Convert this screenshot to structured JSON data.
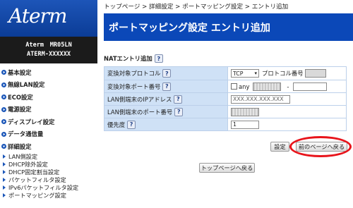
{
  "logo": "Aterm",
  "device": {
    "model": "Aterm　MR05LN",
    "id": "ATERM-XXXXXX"
  },
  "sidebar": {
    "items": [
      {
        "label": "基本設定"
      },
      {
        "label": "無線LAN設定"
      },
      {
        "label": "ECO設定"
      },
      {
        "label": "電源設定"
      },
      {
        "label": "ディスプレイ設定"
      },
      {
        "label": "データ通信量"
      },
      {
        "label": "詳細設定"
      }
    ],
    "subitems": [
      {
        "label": "LAN側設定"
      },
      {
        "label": "DHCP除外設定"
      },
      {
        "label": "DHCP固定割当設定"
      },
      {
        "label": "パケットフィルタ設定"
      },
      {
        "label": "IPv6パケットフィルタ設定"
      },
      {
        "label": "ポートマッピング設定"
      }
    ]
  },
  "breadcrumb": "トップページ > 詳細設定 > ポートマッピング設定 > エントリ追加",
  "title": "ポートマッピング設定 エントリ追加",
  "section": {
    "label": "NATエントリ追加"
  },
  "form": {
    "rows": [
      {
        "label": "変換対象プロトコル"
      },
      {
        "label": "変換対象ポート番号"
      },
      {
        "label": "LAN側端末のIPアドレス"
      },
      {
        "label": "LAN側端末のポート番号"
      },
      {
        "label": "優先度"
      }
    ],
    "protocol_value": "TCP",
    "protocol_number_label": "プロトコル番号",
    "any_label": "any",
    "port_dash": "-",
    "ip_value": "XXX.XXX.XXX.XXX",
    "priority_value": "1"
  },
  "help_glyph": "?",
  "buttons": {
    "settings": "設定",
    "back": "前のページへ戻る",
    "top": "トップページへ戻る"
  },
  "colors": {
    "accent": "#0b48b8",
    "label_bg": "#cfe1f6",
    "highlight": "#e8141b"
  },
  "icons": {
    "nav": "orange-arrow-icon",
    "sub": "blue-triangle-icon",
    "help": "help-icon"
  }
}
